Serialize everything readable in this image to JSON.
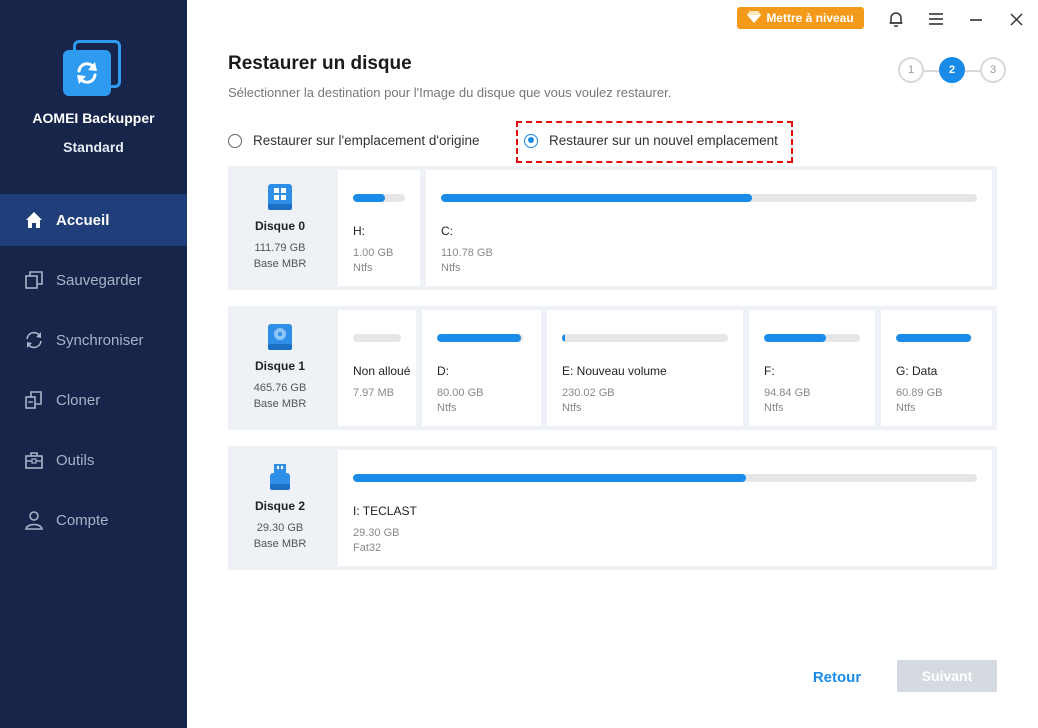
{
  "app": {
    "name": "AOMEI Backupper",
    "edition": "Standard"
  },
  "colors": {
    "sidebar_bg": "#17254a",
    "sidebar_active": "#1f3e7a",
    "accent": "#1a8be6",
    "upgrade": "#f39a1a",
    "highlight": "#e00c0c"
  },
  "sidebar": {
    "items": [
      {
        "label": "Accueil",
        "icon": "home-icon",
        "active": true
      },
      {
        "label": "Sauvegarder",
        "icon": "backup-icon",
        "active": false
      },
      {
        "label": "Synchroniser",
        "icon": "sync-icon",
        "active": false
      },
      {
        "label": "Cloner",
        "icon": "clone-icon",
        "active": false
      },
      {
        "label": "Outils",
        "icon": "toolbox-icon",
        "active": false
      },
      {
        "label": "Compte",
        "icon": "user-icon",
        "active": false
      }
    ]
  },
  "topbar": {
    "upgrade_label": "Mettre à niveau"
  },
  "header": {
    "title": "Restaurer un disque",
    "subtitle": "Sélectionner la destination pour l'Image du disque que vous voulez restaurer."
  },
  "steps": [
    {
      "label": "1",
      "state": "done"
    },
    {
      "label": "2",
      "state": "active"
    },
    {
      "label": "3",
      "state": "pending"
    }
  ],
  "options": {
    "original": "Restaurer sur l'emplacement d'origine",
    "new_location": "Restaurer sur un nouvel emplacement",
    "selected": "new_location"
  },
  "disks": [
    {
      "name": "Disque 0",
      "size": "111.79 GB",
      "type": "Base MBR",
      "icon": "windows-disk-icon",
      "partitions": [
        {
          "label": "H:",
          "size": "1.00 GB",
          "fs": "Ntfs",
          "used_fraction": 0.62
        },
        {
          "label": "C:",
          "size": "110.78 GB",
          "fs": "Ntfs",
          "used_fraction": 0.58
        }
      ]
    },
    {
      "name": "Disque 1",
      "size": "465.76 GB",
      "type": "Base MBR",
      "icon": "hard-disk-icon",
      "partitions": [
        {
          "label": "Non alloué",
          "size": "7.97 MB",
          "fs": "",
          "used_fraction": 0.0
        },
        {
          "label": "D:",
          "size": "80.00 GB",
          "fs": "Ntfs",
          "used_fraction": 0.98
        },
        {
          "label": "E: Nouveau volume",
          "size": "230.02 GB",
          "fs": "Ntfs",
          "used_fraction": 0.02
        },
        {
          "label": "F:",
          "size": "94.84 GB",
          "fs": "Ntfs",
          "used_fraction": 0.65
        },
        {
          "label": "G: Data",
          "size": "60.89 GB",
          "fs": "Ntfs",
          "used_fraction": 0.99
        }
      ]
    },
    {
      "name": "Disque 2",
      "size": "29.30 GB",
      "type": "Base MBR",
      "icon": "usb-drive-icon",
      "partitions": [
        {
          "label": "I: TECLAST",
          "size": "29.30 GB",
          "fs": "Fat32",
          "used_fraction": 0.63
        }
      ]
    }
  ],
  "footer": {
    "back_label": "Retour",
    "next_label": "Suivant"
  }
}
